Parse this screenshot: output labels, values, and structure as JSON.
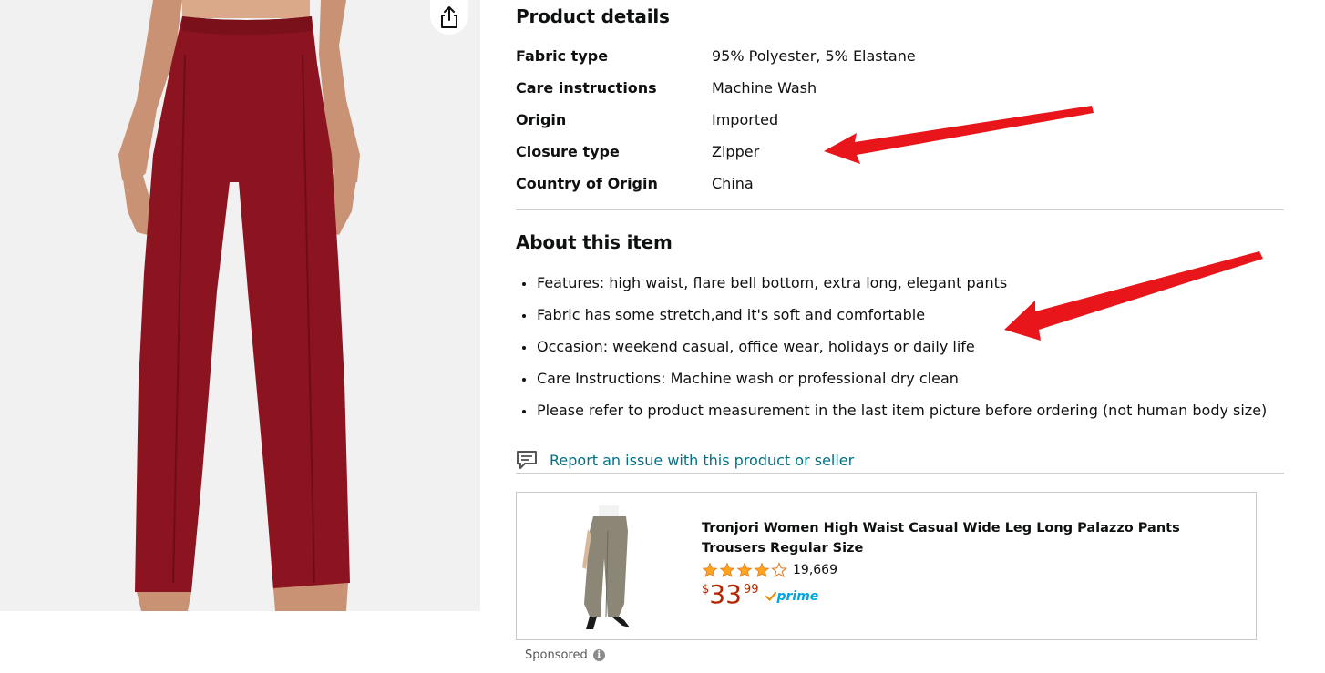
{
  "product_details": {
    "title": "Product details",
    "rows": [
      {
        "key": "Fabric type",
        "value": "95% Polyester, 5% Elastane"
      },
      {
        "key": "Care instructions",
        "value": "Machine Wash"
      },
      {
        "key": "Origin",
        "value": "Imported"
      },
      {
        "key": "Closure type",
        "value": "Zipper"
      },
      {
        "key": "Country of Origin",
        "value": "China"
      }
    ]
  },
  "about": {
    "title": "About this item",
    "bullets": [
      "Features: high waist, flare bell bottom, extra long, elegant pants",
      "Fabric has some stretch,and it's soft and comfortable",
      "Occasion: weekend casual, office wear, holidays or daily life",
      "Care Instructions: Machine wash or professional dry clean",
      "Please refer to product measurement in the last item picture before ordering (not human body size)"
    ]
  },
  "report": {
    "label": "Report an issue with this product or seller",
    "icon": "report-comment-icon"
  },
  "sponsored_product": {
    "title": "Tronjori Women High Waist Casual Wide Leg Long Palazzo Pants Trousers Regular Size",
    "rating": 4.5,
    "rating_count": "19,669",
    "price_symbol": "$",
    "price_whole": "33",
    "price_fraction": "99",
    "prime_label": "prime"
  },
  "sponsored_label": "Sponsored",
  "colors": {
    "link": "#007185",
    "price": "#b12704",
    "star": "#ffa41c",
    "annotation_arrow": "#e8161b",
    "pants": "#8b1420"
  },
  "icons": {
    "share": "share-icon",
    "info": "info-icon",
    "prime_check": "prime-check-icon"
  }
}
